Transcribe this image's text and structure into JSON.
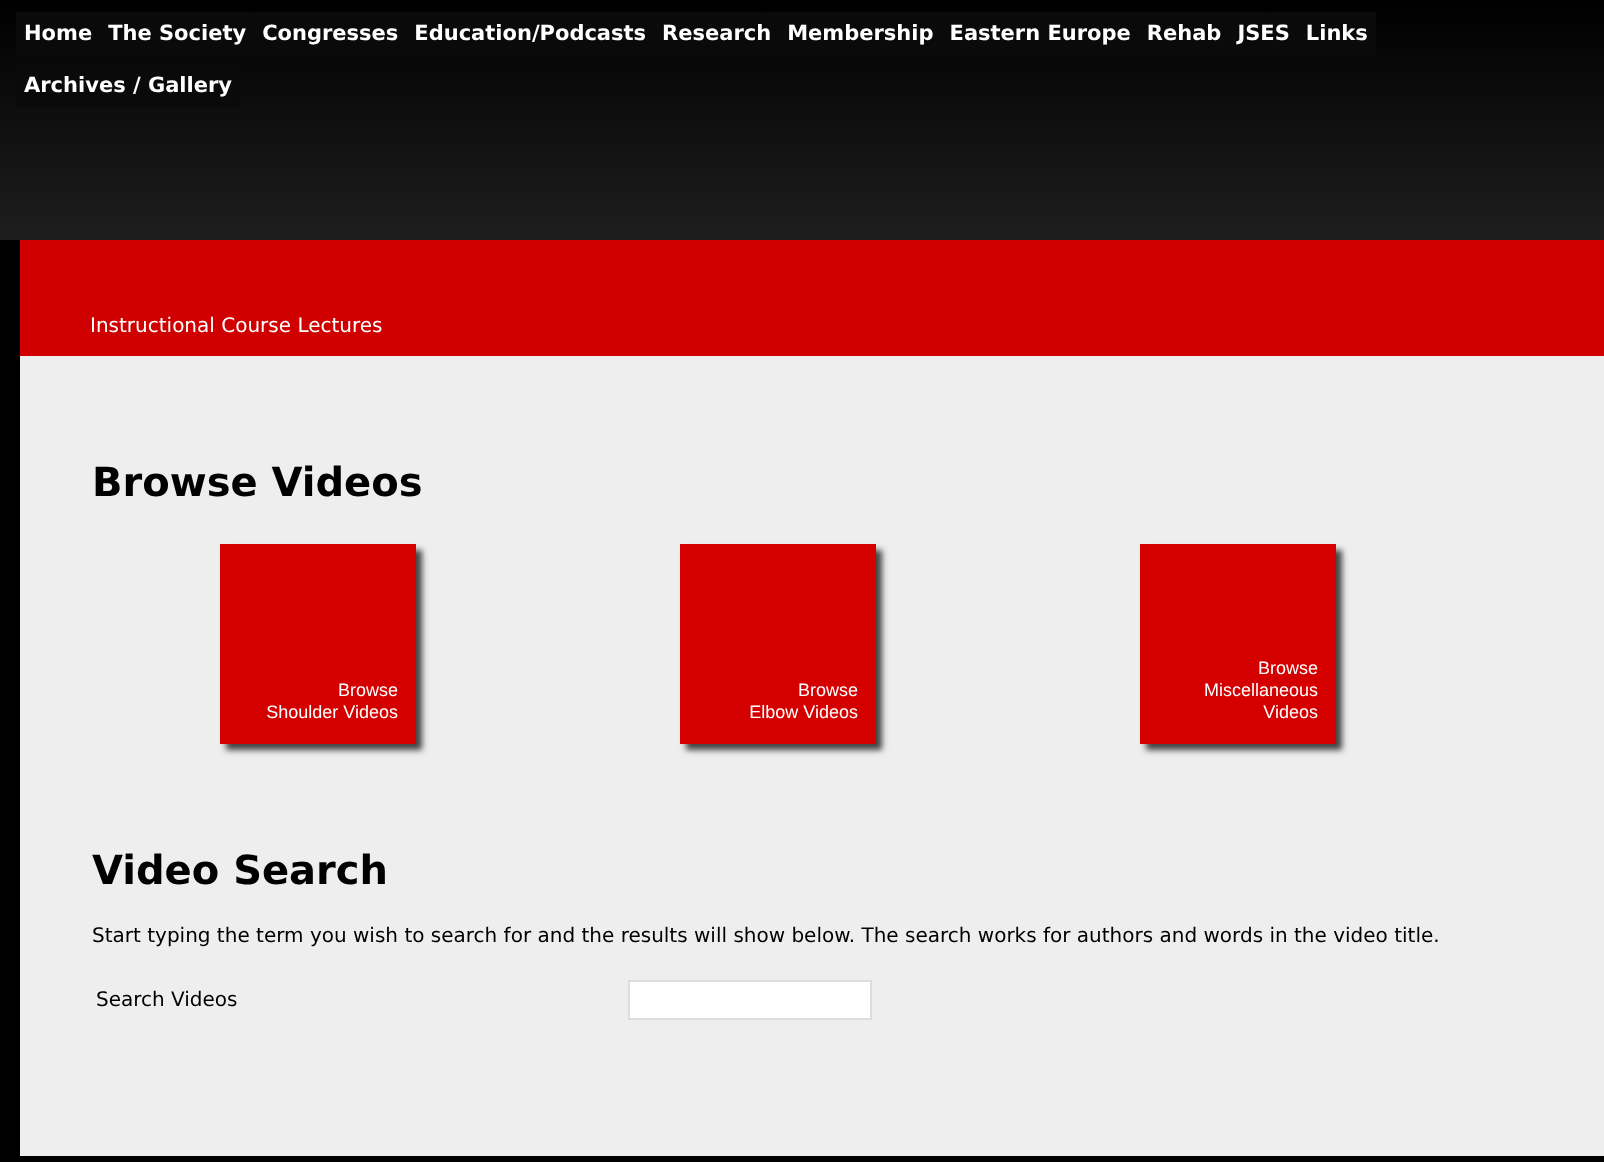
{
  "nav": [
    {
      "label": "Home"
    },
    {
      "label": "The Society"
    },
    {
      "label": "Congresses"
    },
    {
      "label": "Education/Podcasts"
    },
    {
      "label": "Research"
    },
    {
      "label": "Membership"
    },
    {
      "label": "Eastern Europe"
    },
    {
      "label": "Rehab"
    },
    {
      "label": "JSES"
    },
    {
      "label": "Links"
    },
    {
      "label": "Archives / Gallery"
    }
  ],
  "banner": {
    "link": "Instructional Course Lectures"
  },
  "browse": {
    "heading": "Browse Videos",
    "tiles": [
      {
        "lines": [
          "Browse",
          "Shoulder Videos"
        ]
      },
      {
        "lines": [
          "Browse",
          "Elbow Videos"
        ]
      },
      {
        "lines": [
          "Browse",
          "Miscellaneous",
          "Videos"
        ]
      }
    ]
  },
  "search": {
    "heading": "Video Search",
    "description": "Start typing the term you wish to search for and the results will show below. The search works for authors and words in the video title.",
    "label": "Search Videos"
  }
}
